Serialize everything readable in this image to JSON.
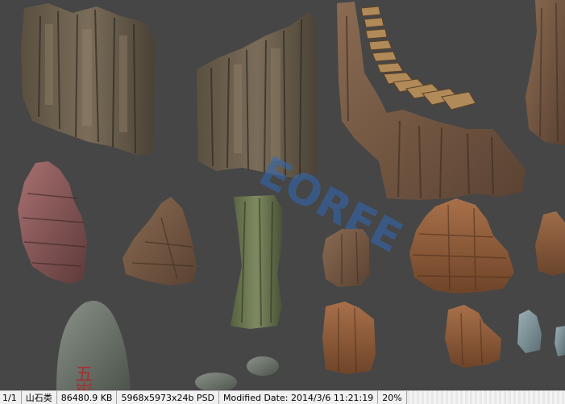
{
  "viewer": {
    "canvas_background": "#464646",
    "watermark_text": "EOREE",
    "stone_characters": "五嶽"
  },
  "statusbar": {
    "index": "1/1",
    "folder": "山石类",
    "file_size": "86480.9 KB",
    "image_info": "5968x5973x24b PSD",
    "modified": "Modified Date: 2014/3/6 11:21:19",
    "zoom": "20%"
  }
}
